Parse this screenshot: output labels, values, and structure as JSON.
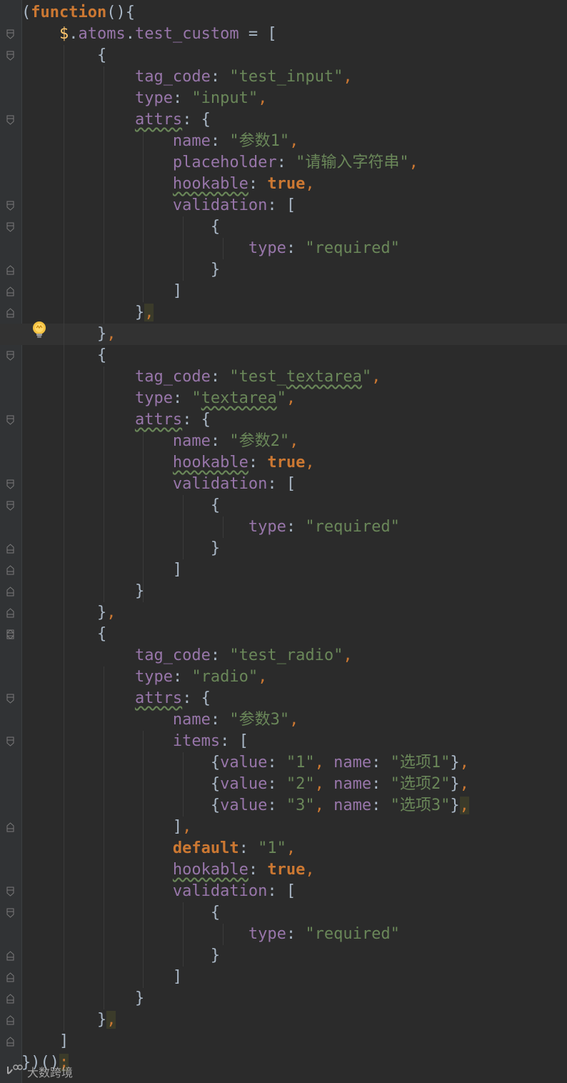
{
  "editor": {
    "language": "javascript",
    "colors": {
      "background": "#2b2b2b",
      "keyword": "#cc7832",
      "string": "#6a8759",
      "property": "#9876aa",
      "text": "#a9b7c6",
      "dollar": "#ffc66d"
    },
    "current_line": 16,
    "lines": [
      "(function(){",
      "    $.atoms.test_custom = [",
      "        {",
      "            tag_code: \"test_input\",",
      "            type: \"input\",",
      "            attrs: {",
      "                name: \"参数1\",",
      "                placeholder: \"请输入字符串\",",
      "                hookable: true,",
      "                validation: [",
      "                    {",
      "                        type: \"required\"",
      "                    }",
      "                ]",
      "            },",
      "        },",
      "        {",
      "            tag_code: \"test_textarea\",",
      "            type: \"textarea\",",
      "            attrs: {",
      "                name: \"参数2\",",
      "                hookable: true,",
      "                validation: [",
      "                    {",
      "                        type: \"required\"",
      "                    }",
      "                ]",
      "            }",
      "        },",
      "        {",
      "            tag_code: \"test_radio\",",
      "            type: \"radio\",",
      "            attrs: {",
      "                name: \"参数3\",",
      "                items: [",
      "                    {value: \"1\", name: \"选项1\"},",
      "                    {value: \"2\", name: \"选项2\"},",
      "                    {value: \"3\", name: \"选项3\"},",
      "                ],",
      "                default: \"1\",",
      "                hookable: true,",
      "                validation: [",
      "                    {",
      "                        type: \"required\"",
      "                    }",
      "                ]",
      "            }",
      "        },",
      "    ]",
      "})();"
    ]
  },
  "intention_icon": "lightbulb-icon",
  "watermark": {
    "icon": "logo-icon",
    "text": "大数跨境"
  }
}
